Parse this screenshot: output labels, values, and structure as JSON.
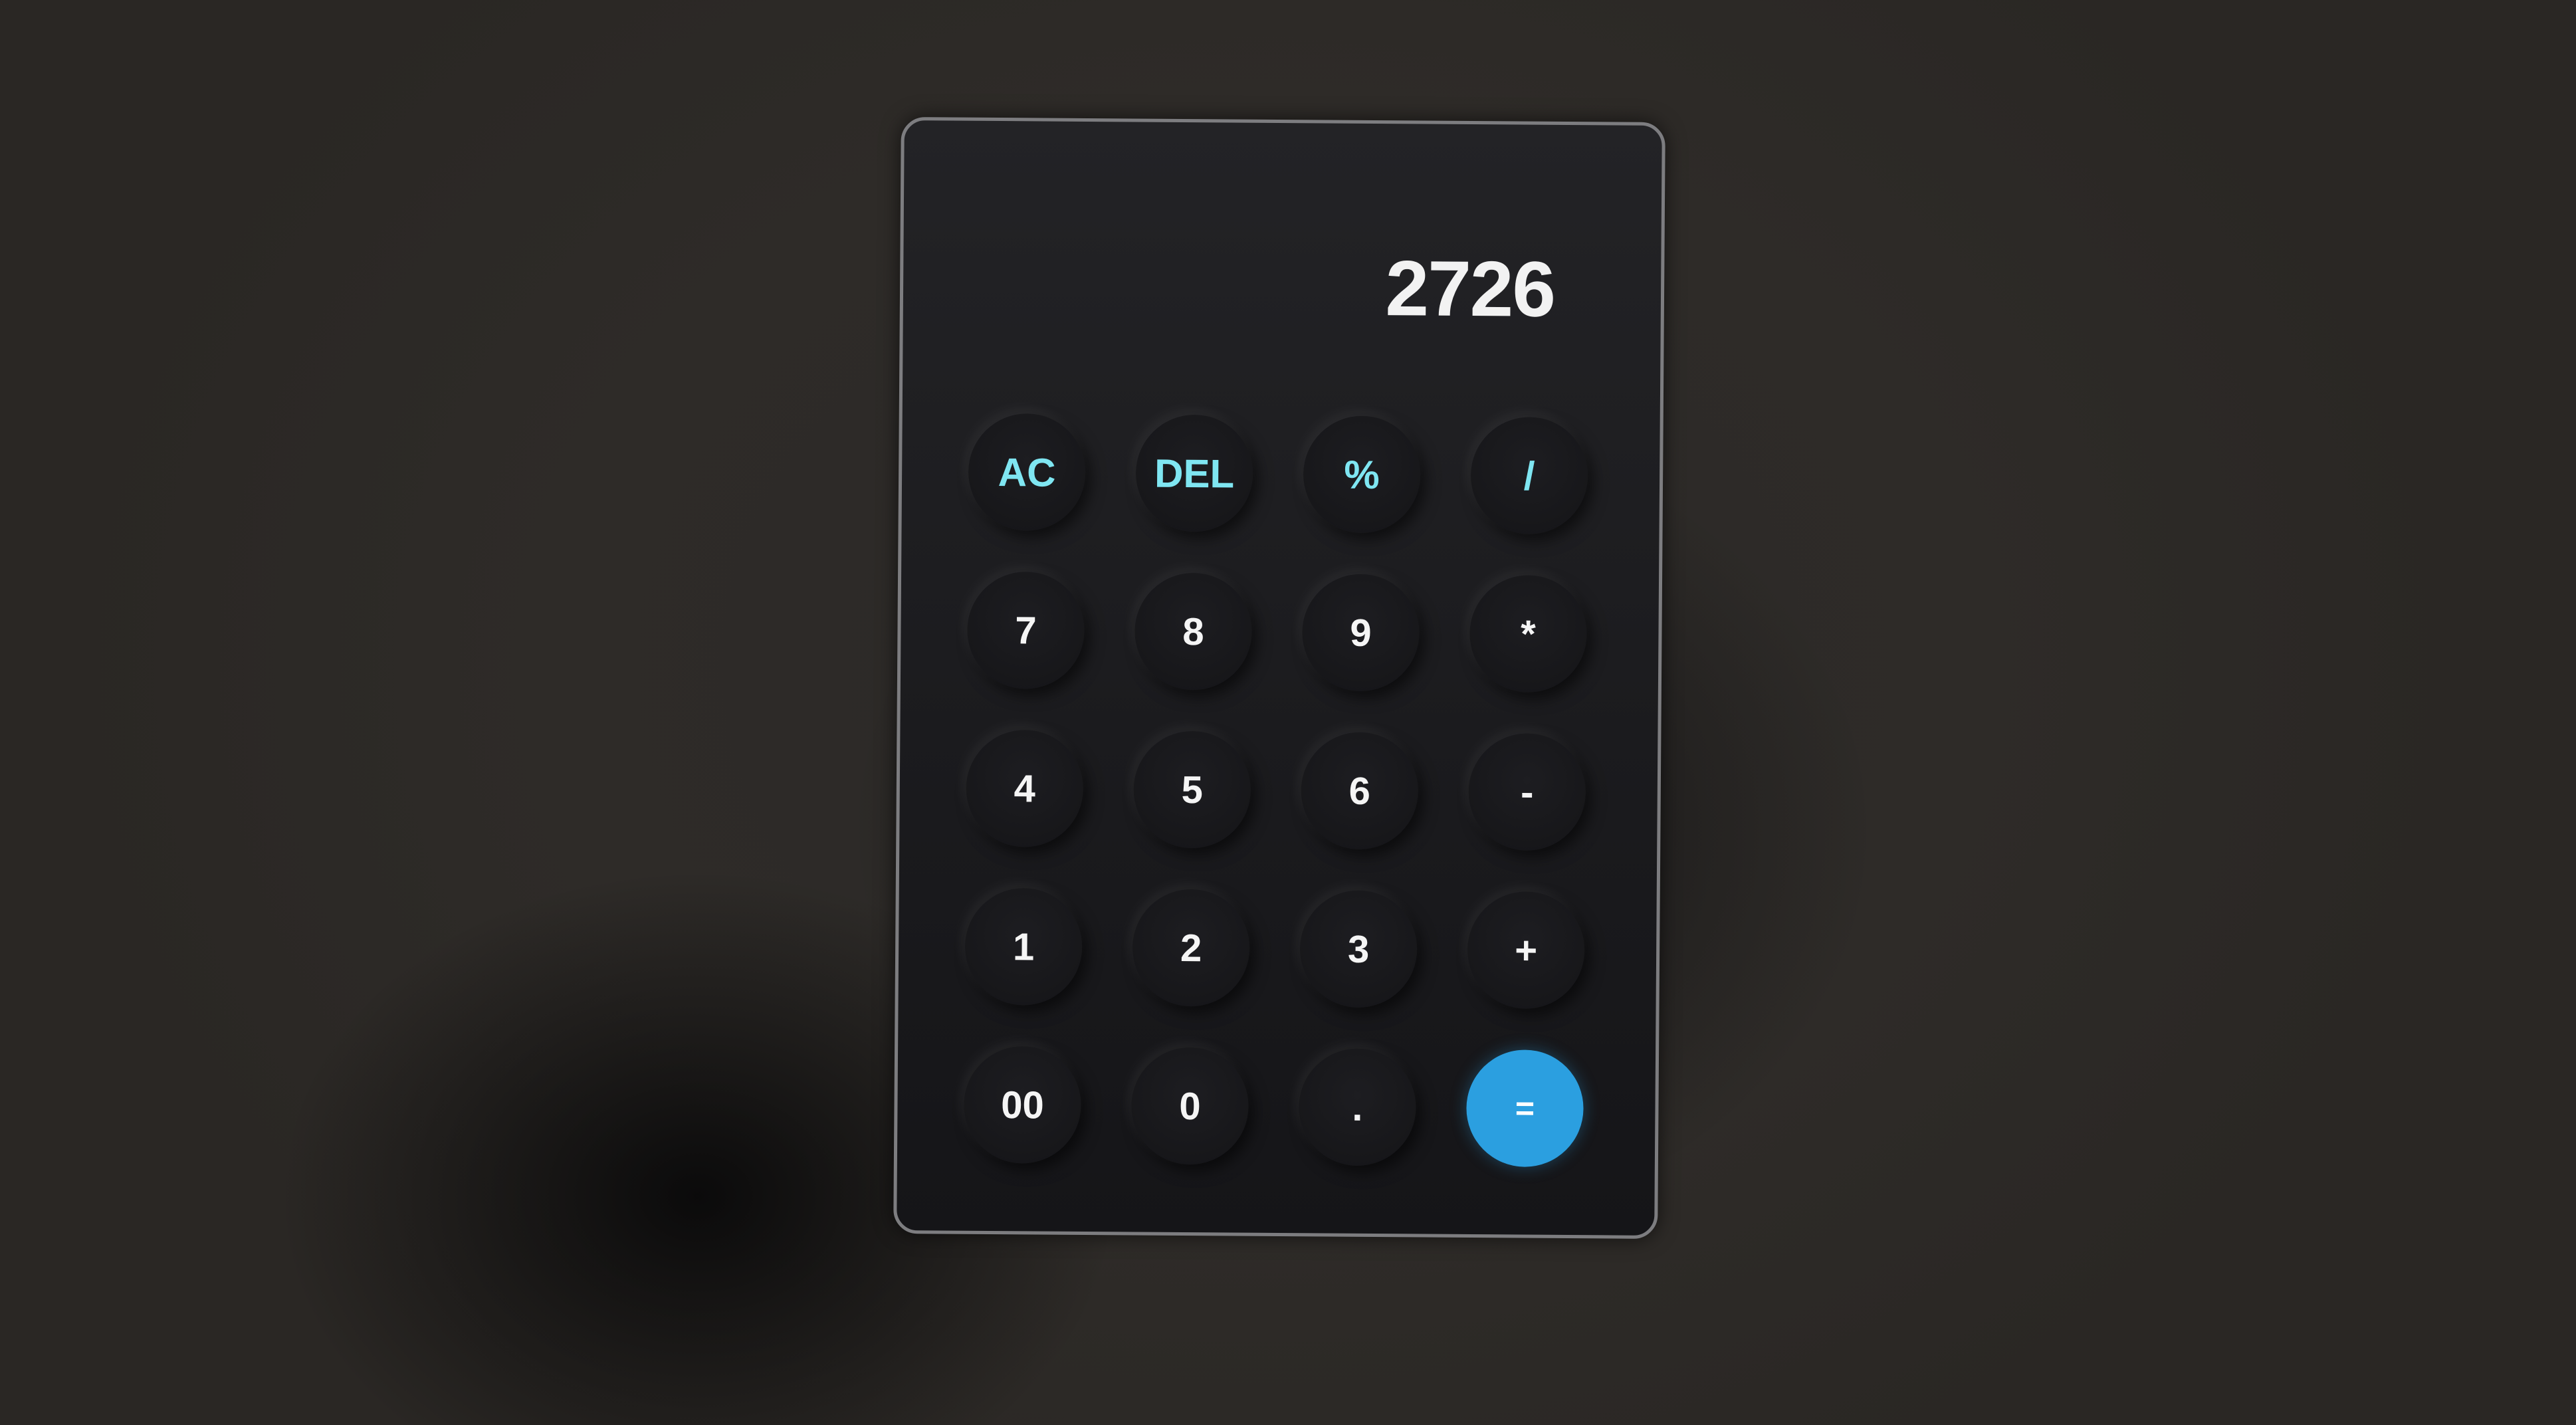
{
  "calculator": {
    "display_value": "2726",
    "keys": {
      "ac": "AC",
      "del": "DEL",
      "percent": "%",
      "divide": "/",
      "seven": "7",
      "eight": "8",
      "nine": "9",
      "multiply": "*",
      "four": "4",
      "five": "5",
      "six": "6",
      "minus": "-",
      "one": "1",
      "two": "2",
      "three": "3",
      "plus": "+",
      "double_zero": "00",
      "zero": "0",
      "decimal": ".",
      "equals": "="
    }
  },
  "colors": {
    "function_key_text": "#7fe6f2",
    "equals_key_background": "#2b9fe0",
    "display_text": "#f2f2f2"
  }
}
